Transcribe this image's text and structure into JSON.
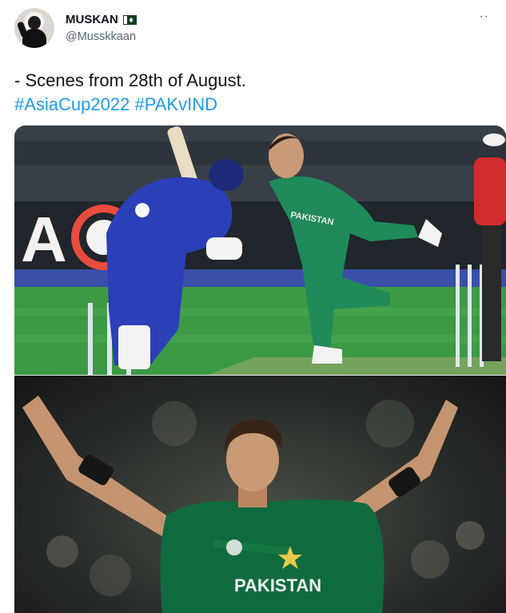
{
  "tweet": {
    "author": {
      "display_name": "MUSKAN",
      "handle": "@Musskkaan",
      "flag_icon": "pakistan-flag-icon"
    },
    "more_label": "··",
    "text_line": "- Scenes from 28th of August.",
    "hashtags": [
      "#AsiaCup2022",
      "#PAKvIND"
    ]
  },
  "media": {
    "top_image": {
      "banner_text": "A",
      "bowler_shirt_text": "PAKISTAN"
    },
    "bottom_image": {
      "shirt_text": "PAKISTAN"
    }
  },
  "colors": {
    "link": "#1d9bf0",
    "text": "#0f1419",
    "secondary": "#536471",
    "pakistan_green": "#0f6b3e",
    "india_blue": "#2b3fb8"
  }
}
